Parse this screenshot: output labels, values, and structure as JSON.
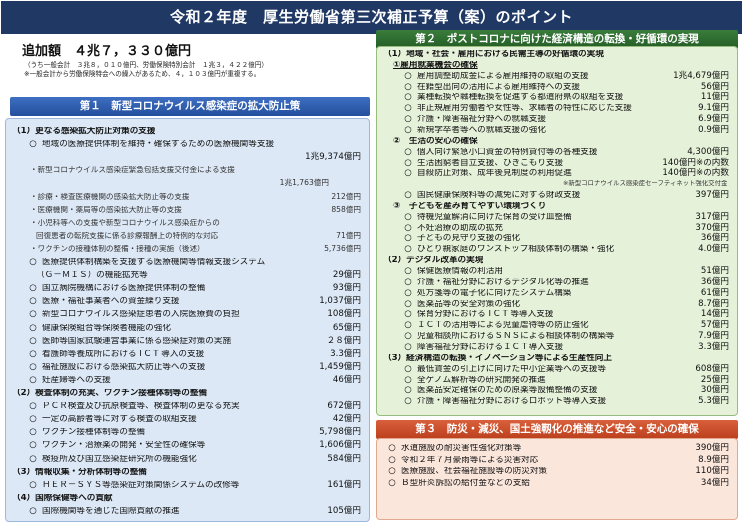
{
  "title": "令和２年度　厚生労働省第三次補正予算（案）のポイント",
  "total": {
    "label": "追加額　４兆７，３３０億円",
    "note1": "（うち一般会計　３兆８，０１０億円、労働保険特別会計　１兆３，４２２億円）",
    "note2": "※一般会計から労働保険特会への繰入があるため、４，１０３億円が重複する。"
  },
  "section1": {
    "header": "第１　新型コロナウイルス感染症の拡大防止策",
    "rows": [
      {
        "kind": "sec",
        "label": "（1）更なる感染拡大防止対策の支援",
        "amount": ""
      },
      {
        "kind": "item",
        "label": "地域の医療提供体制を維持・確保するための医療機関等支援",
        "amount": ""
      },
      {
        "kind": "amt",
        "label": "",
        "amount": "1兆9,374億円"
      },
      {
        "kind": "sub",
        "label": "・新型コロナウイルス感染症緊急包括支援交付金による支援",
        "amount": ""
      },
      {
        "kind": "subamt",
        "label": "",
        "amount": "1兆1,763億円"
      },
      {
        "kind": "sub",
        "label": "・診療・検査医療機関の感染拡大防止等の支援",
        "amount": "212億円"
      },
      {
        "kind": "sub",
        "label": "・医療機関・薬局等の感染拡大防止等の支援",
        "amount": "858億円"
      },
      {
        "kind": "sub",
        "label": "・小児科等への支援や新型コロナウイルス感染症からの",
        "amount": ""
      },
      {
        "kind": "sub2",
        "label": "回復患者の転院支援に係る診療報酬上の特例的な対応",
        "amount": "71億円"
      },
      {
        "kind": "sub",
        "label": "・ワクチンの接種体制の整備・接種の実施（後述）",
        "amount": "5,736億円"
      },
      {
        "kind": "item",
        "label": "医療提供体制構築を支援する医療機関等情報支援システム",
        "amount": ""
      },
      {
        "kind": "cont",
        "label": "（Ｇ－ＭＩＳ）の機能拡充等",
        "amount": "29億円"
      },
      {
        "kind": "item",
        "label": "国立病院機構における医療提供体制の整備",
        "amount": "93億円"
      },
      {
        "kind": "item",
        "label": "医療・福祉事業者への資金繰り支援",
        "amount": "1,037億円"
      },
      {
        "kind": "item",
        "label": "新型コロナウイルス感染症患者の入院医療費の負担",
        "amount": "108億円"
      },
      {
        "kind": "item",
        "label": "健康保険組合等保険者機能の強化",
        "amount": "65億円"
      },
      {
        "kind": "item",
        "label": "医師等国家試験運営事業に係る感染症対策の実施",
        "amount": "２８億円"
      },
      {
        "kind": "item",
        "label": "看護師等養成所における I C T 導入の支援",
        "amount": "3.3億円"
      },
      {
        "kind": "item",
        "label": "福祉施設における感染拡大防止等への支援",
        "amount": "1,459億円"
      },
      {
        "kind": "item",
        "label": "妊産婦等への支援",
        "amount": "46億円"
      },
      {
        "kind": "sec",
        "label": "（2）検査体制の充実、ワクチン接種体制等の整備",
        "amount": ""
      },
      {
        "kind": "item",
        "label": "ＰＣＲ検査及び抗原検査等、検査体制の更なる充実",
        "amount": "672億円"
      },
      {
        "kind": "item",
        "label": "一定の高齢者等に対する検査の取組支援",
        "amount": "42億円"
      },
      {
        "kind": "item",
        "label": "ワクチン接種体制等の整備",
        "amount": "5,798億円"
      },
      {
        "kind": "item",
        "label": "ワクチン・治療薬の開発・安全性の確保等",
        "amount": "1,606億円"
      },
      {
        "kind": "item",
        "label": "検疫所及び国立感染症研究所の機能強化",
        "amount": "584億円"
      },
      {
        "kind": "sec",
        "label": "（3）情報収集・分析体制等の整備",
        "amount": ""
      },
      {
        "kind": "item",
        "label": "ＨＥＲ－ＳＹＳ等感染症対策関係システムの改修等",
        "amount": "161億円"
      },
      {
        "kind": "sec",
        "label": "（4）国際保健等への貢献",
        "amount": ""
      },
      {
        "kind": "item",
        "label": "国際機関等を通じた国際貢献の推進",
        "amount": "105億円"
      }
    ]
  },
  "section2": {
    "header": "第２　ポストコロナに向けた経済構造の転換・好循環の実現",
    "rows": [
      {
        "kind": "sec",
        "label": "（1）地域・社会・雇用における民需主導の好循環の実現",
        "amount": ""
      },
      {
        "kind": "head",
        "label": "①雇用就業機会の確保",
        "amount": ""
      },
      {
        "kind": "item",
        "label": "雇用調整助成金による雇用維持の取組の支援",
        "amount": "1兆4,679億円"
      },
      {
        "kind": "item",
        "label": "在籍型出向の活用による雇用維持への支援",
        "amount": "56億円"
      },
      {
        "kind": "item",
        "label": "業種転換や職種転換を促進する都道府県の取組を支援",
        "amount": "11億円"
      },
      {
        "kind": "item",
        "label": "非正規雇用労働者や女性等、求職者の特性に応じた支援",
        "amount": "9.1億円"
      },
      {
        "kind": "item",
        "label": "介護・障害福祉分野への就職支援",
        "amount": "6.9億円"
      },
      {
        "kind": "item",
        "label": "新規学卒者等への就職支援の強化",
        "amount": "0.9億円"
      },
      {
        "kind": "head",
        "label": "②　生活の安心の確保",
        "amount": ""
      },
      {
        "kind": "item",
        "label": "個人向け緊急小口資金の特例貸付等の各種支援",
        "amount": "4,300億円"
      },
      {
        "kind": "item",
        "label": "生活困窮者自立支援、ひきこもり支援",
        "amount": "140億円※の内数"
      },
      {
        "kind": "item",
        "label": "自殺防止対策、成年後見制度の利用促進",
        "amount": "140億円※の内数"
      },
      {
        "kind": "note",
        "label": "※新型コロナウイルス感染症セーフティネット強化交付金",
        "amount": ""
      },
      {
        "kind": "item",
        "label": "国民健康保険料等の減免に対する財政支援",
        "amount": "397億円"
      },
      {
        "kind": "head",
        "label": "③　子どもを産み育てやすい環境づくり",
        "amount": ""
      },
      {
        "kind": "item",
        "label": "待機児童解消に向けた保育の受け皿整備",
        "amount": "317億円"
      },
      {
        "kind": "item",
        "label": "不妊治療の助成の拡充",
        "amount": "370億円"
      },
      {
        "kind": "item",
        "label": "子どもの見守り支援の強化",
        "amount": "36億円"
      },
      {
        "kind": "item",
        "label": "ひとり親家庭のワンストップ相談体制の構築・強化",
        "amount": "4.0億円"
      },
      {
        "kind": "sec",
        "label": "（2）デジタル改革の実現",
        "amount": ""
      },
      {
        "kind": "item",
        "label": "保健医療情報の利活用",
        "amount": "51億円"
      },
      {
        "kind": "item",
        "label": "介護・福祉分野におけるデジタル化等の推進",
        "amount": "36億円"
      },
      {
        "kind": "item",
        "label": "処方箋等の電子化に向けたシステム構築",
        "amount": "61億円"
      },
      {
        "kind": "item",
        "label": "医薬品等の安全対策の強化",
        "amount": "8.7億円"
      },
      {
        "kind": "item",
        "label": "保育分野における I C T 等導入支援",
        "amount": "14億円"
      },
      {
        "kind": "item",
        "label": "ＩＣＴの活用等による児童虐待等の防止強化",
        "amount": "57億円"
      },
      {
        "kind": "item",
        "label": "児童相談所におけるＳＮＳによる相談体制の構築等",
        "amount": "7.9億円"
      },
      {
        "kind": "item",
        "label": "障害福祉分野におけるＩＣＴ導入支援",
        "amount": "3.3億円"
      },
      {
        "kind": "sec",
        "label": "（3）経済構造の転換・イノベーション等による生産性向上",
        "amount": ""
      },
      {
        "kind": "item",
        "label": "最低賃金の引上げに向けた中小企業等への支援等",
        "amount": "608億円"
      },
      {
        "kind": "item",
        "label": "全ゲノム解析等の研究開発の推進",
        "amount": "25億円"
      },
      {
        "kind": "item",
        "label": "医薬品安定確保のための原薬等設備整備の支援",
        "amount": "30億円"
      },
      {
        "kind": "item",
        "label": "介護・障害福祉分野におけるロボット等導入支援",
        "amount": "5.3億円"
      }
    ]
  },
  "section3": {
    "header": "第３　防災・減災、国土強靱化の推進など安全・安心の確保",
    "rows": [
      {
        "kind": "item",
        "label": "水道施設の耐災害性強化対策等",
        "amount": "390億円"
      },
      {
        "kind": "item",
        "label": "令和２年７月豪雨等による災害対応",
        "amount": "8.9億円"
      },
      {
        "kind": "item",
        "label": "医療施設、社会福祉施設等の防災対策",
        "amount": "110億円"
      },
      {
        "kind": "item",
        "label": "Ｂ型肝炎訴訟の給付金などの支給",
        "amount": "34億円"
      }
    ]
  },
  "icons": {
    "bullet": "circle-bullet"
  },
  "colors": {
    "title_bg": "#1f3864",
    "blue_header": "#234f9c",
    "green_header": "#235b25",
    "red_header": "#bb3f1c"
  }
}
